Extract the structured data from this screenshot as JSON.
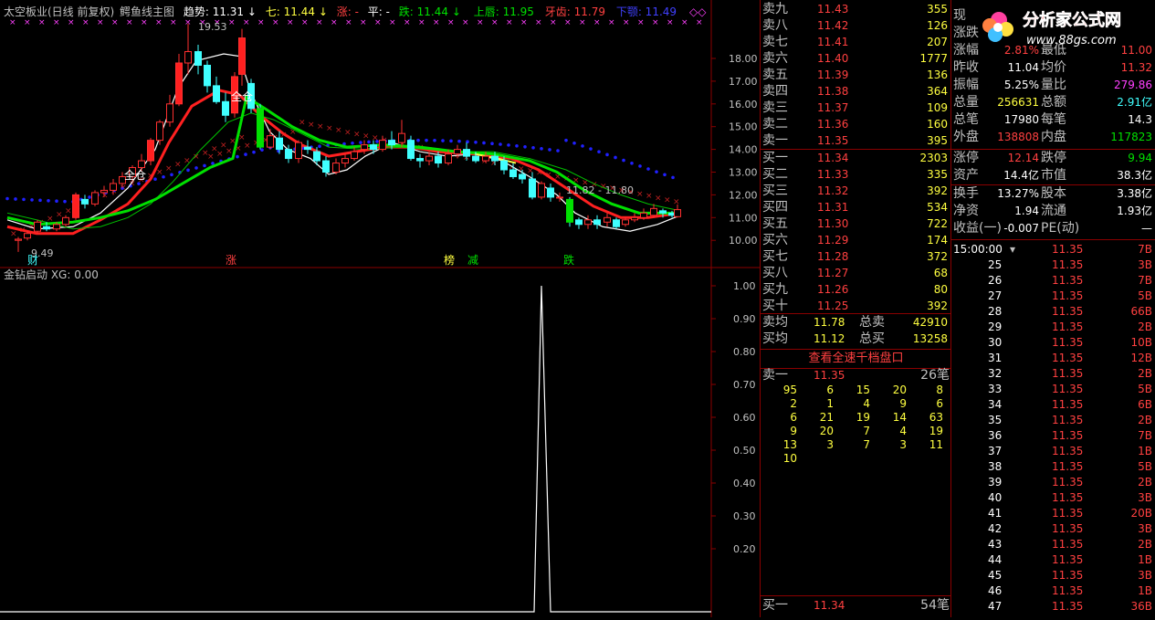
{
  "main_chart": {
    "title": "太空板业(日线 前复权)",
    "indicator": "鳄鱼线主图",
    "trend_label": "趋势: 11.31",
    "arrow_down": "↓",
    "seven_label": "七: 11.44",
    "zhang_label": "涨: -",
    "ping_label": "平: -",
    "die_label": "跌: 11.44",
    "upper_label": "上唇: 11.95",
    "teeth_label": "牙齿: 11.79",
    "jaw_label": "下颚: 11.49",
    "high_mark": "19.53",
    "low_mark": "9.49",
    "range_mark": "11.82 - 11.80",
    "quancang1": "全仓",
    "quancang2": "全仓",
    "cai": "财",
    "zhang": "涨",
    "bang": "榜",
    "jian": "减",
    "die": "跌",
    "yaxis": [
      "18.00",
      "17.00",
      "16.00",
      "15.00",
      "14.00",
      "13.00",
      "12.00",
      "11.00",
      "10.00"
    ]
  },
  "sub_chart": {
    "title": "金钻启动 XG: 0.00",
    "yaxis": [
      "1.00",
      "0.90",
      "0.80",
      "0.70",
      "0.60",
      "0.50",
      "0.40",
      "0.30",
      "0.20"
    ]
  },
  "order_book": {
    "asks": [
      {
        "label": "卖九",
        "price": "11.43",
        "vol": "355"
      },
      {
        "label": "卖八",
        "price": "11.42",
        "vol": "126"
      },
      {
        "label": "卖七",
        "price": "11.41",
        "vol": "207"
      },
      {
        "label": "卖六",
        "price": "11.40",
        "vol": "1777"
      },
      {
        "label": "卖五",
        "price": "11.39",
        "vol": "136"
      },
      {
        "label": "卖四",
        "price": "11.38",
        "vol": "364"
      },
      {
        "label": "卖三",
        "price": "11.37",
        "vol": "109"
      },
      {
        "label": "卖二",
        "price": "11.36",
        "vol": "160"
      },
      {
        "label": "卖一",
        "price": "11.35",
        "vol": "395"
      }
    ],
    "bids": [
      {
        "label": "买一",
        "price": "11.34",
        "vol": "2303"
      },
      {
        "label": "买二",
        "price": "11.33",
        "vol": "335"
      },
      {
        "label": "买三",
        "price": "11.32",
        "vol": "392"
      },
      {
        "label": "买四",
        "price": "11.31",
        "vol": "534"
      },
      {
        "label": "买五",
        "price": "11.30",
        "vol": "722"
      },
      {
        "label": "买六",
        "price": "11.29",
        "vol": "174"
      },
      {
        "label": "买七",
        "price": "11.28",
        "vol": "372"
      },
      {
        "label": "买八",
        "price": "11.27",
        "vol": "68"
      },
      {
        "label": "买九",
        "price": "11.26",
        "vol": "80"
      },
      {
        "label": "买十",
        "price": "11.25",
        "vol": "392"
      }
    ],
    "ask_avg_label": "卖均",
    "ask_avg": "11.78",
    "ask_total_label": "总卖",
    "ask_total": "42910",
    "bid_avg_label": "买均",
    "bid_avg": "11.12",
    "bid_total_label": "总买",
    "bid_total": "13258",
    "depth_button": "查看全速千档盘口",
    "queue_label": "卖一",
    "queue_price": "11.35",
    "queue_count": "26笔",
    "queue": [
      [
        "95",
        "6",
        "15",
        "20",
        "8"
      ],
      [
        "2",
        "1",
        "4",
        "9",
        "6"
      ],
      [
        "6",
        "21",
        "19",
        "14",
        "63"
      ],
      [
        "9",
        "20",
        "7",
        "4",
        "19"
      ],
      [
        "13",
        "3",
        "7",
        "3",
        "11"
      ],
      [
        "10"
      ]
    ],
    "bottom_label": "买一",
    "bottom_price": "11.34",
    "bottom_count": "54笔"
  },
  "quote_info": {
    "rows": [
      {
        "l1": "现",
        "v1": "",
        "l2": "",
        "v2": ""
      },
      {
        "l1": "涨跌",
        "v1": "",
        "l2": "",
        "v2": ""
      },
      {
        "l1": "涨幅",
        "v1": "2.81%",
        "l2": "最低",
        "v2": "11.00"
      },
      {
        "l1": "昨收",
        "v1": "11.04",
        "l2": "均价",
        "v2": "11.32"
      },
      {
        "l1": "振幅",
        "v1": "5.25%",
        "l2": "量比",
        "v2": "279.86"
      },
      {
        "l1": "总量",
        "v1": "256631",
        "l2": "总额",
        "v2": "2.91亿"
      },
      {
        "l1": "总笔",
        "v1": "17980",
        "l2": "每笔",
        "v2": "14.3"
      },
      {
        "l1": "外盘",
        "v1": "138808",
        "l2": "内盘",
        "v2": "117823"
      }
    ],
    "rows2": [
      {
        "l1": "涨停",
        "v1": "12.14",
        "l2": "跌停",
        "v2": "9.94"
      },
      {
        "l1": "资产",
        "v1": "14.4亿",
        "l2": "市值",
        "v2": "38.3亿"
      }
    ],
    "rows3": [
      {
        "l1": "换手",
        "v1": "13.27%",
        "l2": "股本",
        "v2": "3.38亿"
      },
      {
        "l1": "净资",
        "v1": "1.94",
        "l2": "流通",
        "v2": "1.93亿"
      },
      {
        "l1": "收益(一)",
        "v1": "-0.007",
        "l2": "PE(动)",
        "v2": "—"
      }
    ],
    "logo_text": "分析家公式网",
    "logo_url": "www.88gs.com"
  },
  "ticks": {
    "first_time": "15:00:00",
    "first_price": "11.35",
    "first_vol": "7B",
    "items": [
      {
        "t": "25",
        "p": "11.35",
        "v": "3B"
      },
      {
        "t": "26",
        "p": "11.35",
        "v": "7B"
      },
      {
        "t": "27",
        "p": "11.35",
        "v": "5B"
      },
      {
        "t": "28",
        "p": "11.35",
        "v": "66B"
      },
      {
        "t": "29",
        "p": "11.35",
        "v": "2B"
      },
      {
        "t": "30",
        "p": "11.35",
        "v": "10B"
      },
      {
        "t": "31",
        "p": "11.35",
        "v": "12B"
      },
      {
        "t": "32",
        "p": "11.35",
        "v": "2B"
      },
      {
        "t": "33",
        "p": "11.35",
        "v": "5B"
      },
      {
        "t": "34",
        "p": "11.35",
        "v": "6B"
      },
      {
        "t": "35",
        "p": "11.35",
        "v": "2B"
      },
      {
        "t": "36",
        "p": "11.35",
        "v": "7B"
      },
      {
        "t": "37",
        "p": "11.35",
        "v": "1B"
      },
      {
        "t": "38",
        "p": "11.35",
        "v": "5B"
      },
      {
        "t": "39",
        "p": "11.35",
        "v": "2B"
      },
      {
        "t": "40",
        "p": "11.35",
        "v": "3B"
      },
      {
        "t": "41",
        "p": "11.35",
        "v": "20B"
      },
      {
        "t": "42",
        "p": "11.35",
        "v": "3B"
      },
      {
        "t": "43",
        "p": "11.35",
        "v": "2B"
      },
      {
        "t": "44",
        "p": "11.35",
        "v": "1B"
      },
      {
        "t": "45",
        "p": "11.35",
        "v": "3B"
      },
      {
        "t": "46",
        "p": "11.35",
        "v": "1B"
      },
      {
        "t": "47",
        "p": "11.35",
        "v": "36B"
      }
    ]
  },
  "colors": {
    "up": "#ff3030",
    "down": "#40ffff",
    "ma_white": "#ffffff",
    "ma_red": "#ff2020",
    "ma_green": "#00e000",
    "ma_yellow": "#ffff40",
    "dots_blue": "#2020ff",
    "cross_red": "#c02020",
    "grid": "#8b0000"
  }
}
